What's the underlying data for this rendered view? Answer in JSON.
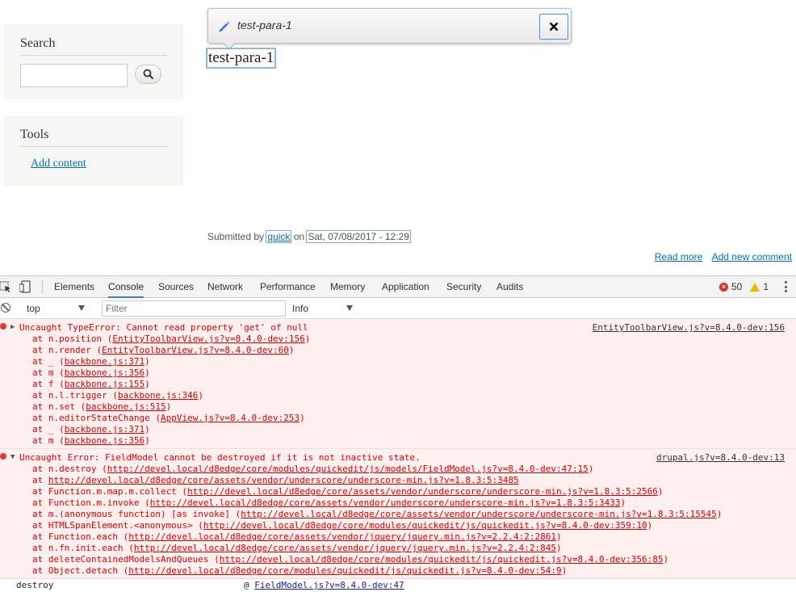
{
  "sidebar": {
    "search": {
      "title": "Search",
      "input_value": ""
    },
    "tools": {
      "title": "Tools",
      "add_content": "Add content"
    }
  },
  "quickedit": {
    "title": "test-para-1"
  },
  "node": {
    "title": "test-para-1",
    "submitted_prefix": "Submitted by",
    "author": "quick",
    "on_text": "on",
    "date": "Sat, 07/08/2017 - 12:29"
  },
  "links": {
    "read_more": "Read more",
    "add_comment": "Add new comment"
  },
  "devtools": {
    "tabs": [
      "Elements",
      "Console",
      "Sources",
      "Network",
      "Performance",
      "Memory",
      "Application",
      "Security",
      "Audits"
    ],
    "active_tab": "Console",
    "error_count": "50",
    "warning_count": "1",
    "context": "top",
    "filter_placeholder": "Filter",
    "level": "Info"
  },
  "console": {
    "error1": {
      "message": "Uncaught TypeError: Cannot read property 'get' of null",
      "source": "EntityToolbarView.js?v=8.4.0-dev:156",
      "stack": [
        {
          "fn": "at n.position (",
          "link": "EntityToolbarView.js?v=8.4.0-dev:156",
          "end": ")"
        },
        {
          "fn": "at n.render (",
          "link": "EntityToolbarView.js?v=8.4.0-dev:60",
          "end": ")"
        },
        {
          "fn": "at _ (",
          "link": "backbone.js:371",
          "end": ")"
        },
        {
          "fn": "at m (",
          "link": "backbone.js:356",
          "end": ")"
        },
        {
          "fn": "at f (",
          "link": "backbone.js:155",
          "end": ")"
        },
        {
          "fn": "at n.l.trigger (",
          "link": "backbone.js:346",
          "end": ")"
        },
        {
          "fn": "at n.set (",
          "link": "backbone.js:515",
          "end": ")"
        },
        {
          "fn": "at n.editorStateChange (",
          "link": "AppView.js?v=8.4.0-dev:253",
          "end": ")"
        },
        {
          "fn": "at _ (",
          "link": "backbone.js:371",
          "end": ")"
        },
        {
          "fn": "at m (",
          "link": "backbone.js:356",
          "end": ")"
        }
      ]
    },
    "error2": {
      "message": "Uncaught Error: FieldModel cannot be destroyed if it is not inactive state.",
      "source": "drupal.js?v=8.4.0-dev:13",
      "stack": [
        {
          "fn": "at n.destroy (",
          "link": "http://devel.local/d8edge/core/modules/quickedit/js/models/FieldModel.js?v=8.4.0-dev:47:15",
          "end": ")"
        },
        {
          "fn": "at ",
          "link": "http://devel.local/d8edge/core/assets/vendor/underscore/underscore-min.js?v=1.8.3:5:3485",
          "end": ""
        },
        {
          "fn": "at Function.m.map.m.collect (",
          "link": "http://devel.local/d8edge/core/assets/vendor/underscore/underscore-min.js?v=1.8.3:5:2566",
          "end": ")"
        },
        {
          "fn": "at Function.m.invoke (",
          "link": "http://devel.local/d8edge/core/assets/vendor/underscore/underscore-min.js?v=1.8.3:5:3433",
          "end": ")"
        },
        {
          "fn": "at m.(anonymous function) [as invoke] (",
          "link": "http://devel.local/d8edge/core/assets/vendor/underscore/underscore-min.js?v=1.8.3:5:15545",
          "end": ")"
        },
        {
          "fn": "at HTMLSpanElement.<anonymous> (",
          "link": "http://devel.local/d8edge/core/modules/quickedit/js/quickedit.js?v=8.4.0-dev:359:10",
          "end": ")"
        },
        {
          "fn": "at Function.each (",
          "link": "http://devel.local/d8edge/core/assets/vendor/jquery/jquery.min.js?v=2.2.4:2:2861",
          "end": ")"
        },
        {
          "fn": "at n.fn.init.each (",
          "link": "http://devel.local/d8edge/core/assets/vendor/jquery/jquery.min.js?v=2.2.4:2:845",
          "end": ")"
        },
        {
          "fn": "at deleteContainedModelsAndQueues (",
          "link": "http://devel.local/d8edge/core/modules/quickedit/js/quickedit.js?v=8.4.0-dev:356:85",
          "end": ")"
        },
        {
          "fn": "at Object.detach (",
          "link": "http://devel.local/d8edge/core/modules/quickedit/js/quickedit.js?v=8.4.0-dev:54:9",
          "end": ")"
        }
      ]
    },
    "log": {
      "label": "destroy",
      "at": "@",
      "link": "FieldModel.js?v=8.4.0-dev:47"
    }
  }
}
